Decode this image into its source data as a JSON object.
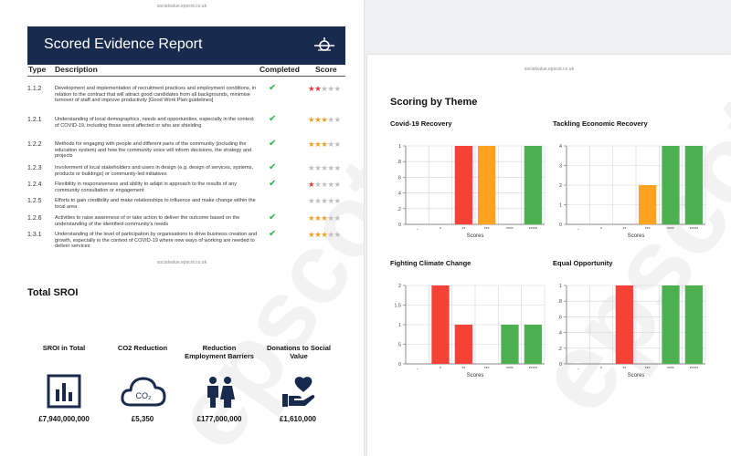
{
  "site_url": "socialvalue.epscot.co.uk",
  "watermark": "epscot",
  "report": {
    "title": "Scored Evidence Report",
    "columns": {
      "type": "Type",
      "description": "Description",
      "completed": "Completed",
      "score": "Score"
    },
    "rows": [
      {
        "type": "1.1.2",
        "description": "Development and implementation of recruitment practices and employment conditions, in relation to the contract that will attract good candidates from all backgrounds, minimise turnover of staff and improve productivity [Good Work Plan guidelines]",
        "completed": "✔",
        "score": 2,
        "score_color": "red"
      },
      {
        "type": "1.2.1",
        "description": "Understanding of local demographics, needs and opportunities, especially in the context of COVID-19, including those worst affected or who are shielding",
        "completed": "✔",
        "score": 3,
        "score_color": "orange"
      },
      {
        "type": "1.2.2",
        "description": "Methods for engaging with people and different parts of the community (including the education system) and how the community voice will inform decisions, the strategy and projects",
        "completed": "✔",
        "score": 3,
        "score_color": "orange"
      },
      {
        "type": "1.2.3",
        "description": "Involvement of local stakeholders and users in design (e.g. design of services, systems, products or buildings) or community-led initiatives",
        "completed": "✔",
        "score": 0,
        "score_color": "grey"
      },
      {
        "type": "1.2.4",
        "description": "Flexibility in responsiveness and ability to adapt in approach to the results of any community consultation or engagement",
        "completed": "✔",
        "score": 1,
        "score_color": "red"
      },
      {
        "type": "1.2.5",
        "description": "Efforts to gain credibility and make relationships to influence and make change within the local area",
        "completed": "",
        "score": 0,
        "score_color": "grey"
      },
      {
        "type": "1.2.6",
        "description": "Activities to raise awareness of or take action to deliver the outcome based on the understanding of the identified community's needs",
        "completed": "✔",
        "score": 3,
        "score_color": "orange"
      },
      {
        "type": "1.3.1",
        "description": "Understanding of the level of participation by organisations to drive business creation and growth, especially in the context of COVID-19 where new ways of working are needed to deliver services",
        "completed": "✔",
        "score": 3,
        "score_color": "orange"
      }
    ]
  },
  "total_sroi": {
    "title": "Total SROI",
    "stats": [
      {
        "label": "SROI in Total",
        "value": "£7,940,000,000",
        "icon": "bar-chart-icon"
      },
      {
        "label": "CO2 Reduction",
        "value": "£5,350",
        "icon": "co2-cloud-icon",
        "icon_text": "CO₂"
      },
      {
        "label": "Reduction Employment Barriers",
        "value": "£177,000,000",
        "icon": "people-icon"
      },
      {
        "label": "Donations to Social Value",
        "value": "£1,610,000",
        "icon": "heart-hand-icon"
      }
    ]
  },
  "scoring": {
    "title": "Scoring by Theme",
    "colors": {
      "red": "#f44336",
      "orange": "#ffa220",
      "green": "#4caf50"
    },
    "star_color": {
      "red": "#e53935",
      "orange": "#f0a020",
      "grey": "#bdbdbd"
    }
  },
  "chart_data": [
    {
      "type": "bar",
      "title": "Covid-19 Recovery",
      "xlabel": "Scores",
      "ylabel": "",
      "categories": [
        "-",
        "*",
        "**",
        "***",
        "****",
        "*****"
      ],
      "values": [
        0,
        0,
        1,
        1,
        0,
        1
      ],
      "ylim": [
        0,
        1
      ],
      "yticks": [
        0,
        0.2,
        0.4,
        0.6,
        0.8,
        1
      ],
      "ytick_labels": [
        "0",
        ".2",
        ".4",
        ".6",
        ".8",
        "1"
      ],
      "bar_colors": [
        "",
        "",
        "red",
        "orange",
        "",
        "green"
      ],
      "grid": true
    },
    {
      "type": "bar",
      "title": "Tackling Economic Recovery",
      "xlabel": "Scores",
      "ylabel": "",
      "categories": [
        "-",
        "*",
        "**",
        "***",
        "****",
        "*****"
      ],
      "values": [
        0,
        0,
        0,
        2,
        4,
        4
      ],
      "ylim": [
        0,
        4
      ],
      "yticks": [
        0,
        1,
        2,
        3,
        4
      ],
      "ytick_labels": [
        "0",
        "1",
        "2",
        "3",
        "4"
      ],
      "bar_colors": [
        "",
        "",
        "",
        "orange",
        "green",
        "green"
      ],
      "grid": true
    },
    {
      "type": "bar",
      "title": "Fighting Climate Change",
      "xlabel": "Scores",
      "ylabel": "",
      "categories": [
        "-",
        "*",
        "**",
        "***",
        "****",
        "*****"
      ],
      "values": [
        0,
        2,
        1,
        0,
        1,
        1
      ],
      "ylim": [
        0,
        2
      ],
      "yticks": [
        0,
        0.5,
        1,
        1.5,
        2
      ],
      "ytick_labels": [
        "0",
        ".5",
        "1",
        "1.5",
        "2"
      ],
      "bar_colors": [
        "",
        "red",
        "red",
        "",
        "green",
        "green"
      ],
      "grid": true
    },
    {
      "type": "bar",
      "title": "Equal Opportunity",
      "xlabel": "Scores",
      "ylabel": "",
      "categories": [
        "-",
        "*",
        "**",
        "***",
        "****",
        "*****"
      ],
      "values": [
        0,
        0,
        1,
        0,
        1,
        1
      ],
      "ylim": [
        0,
        1
      ],
      "yticks": [
        0,
        0.2,
        0.4,
        0.6,
        0.8,
        1
      ],
      "ytick_labels": [
        "0",
        ".2",
        ".4",
        ".6",
        ".8",
        "1"
      ],
      "bar_colors": [
        "",
        "",
        "red",
        "",
        "green",
        "green"
      ],
      "grid": true
    }
  ]
}
